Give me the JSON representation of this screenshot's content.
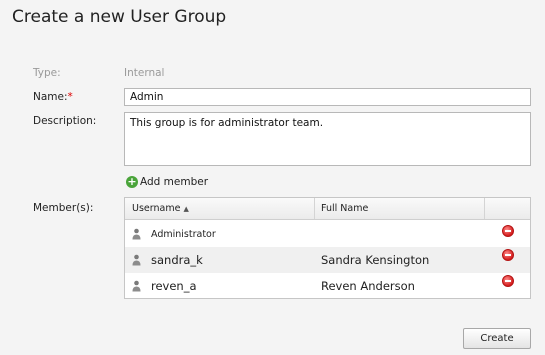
{
  "dialog": {
    "title": "Create a new User Group"
  },
  "form": {
    "type_label": "Type:",
    "type_value": "Internal",
    "name_label": "Name:",
    "name_required_mark": "*",
    "name_value": "Admin",
    "description_label": "Description:",
    "description_value": "This group is for administrator team.",
    "members_label": "Member(s):"
  },
  "members": {
    "add_label": "Add member",
    "columns": {
      "username": "Username",
      "full_name": "Full Name"
    },
    "sort": "username-ascending",
    "rows": [
      {
        "username": "Administrator",
        "full_name": ""
      },
      {
        "username": "sandra_k",
        "full_name": "Sandra Kensington"
      },
      {
        "username": "reven_a",
        "full_name": "Reven Anderson"
      }
    ]
  },
  "actions": {
    "create_label": "Create"
  },
  "icons": {
    "add": "plus-circle-icon",
    "user": "user-icon",
    "remove": "remove-circle-icon",
    "sort": "sort-ascending-icon"
  },
  "colors": {
    "add_icon": "#4aa43a",
    "remove_icon": "#d41e1e",
    "required": "#dd0000"
  }
}
